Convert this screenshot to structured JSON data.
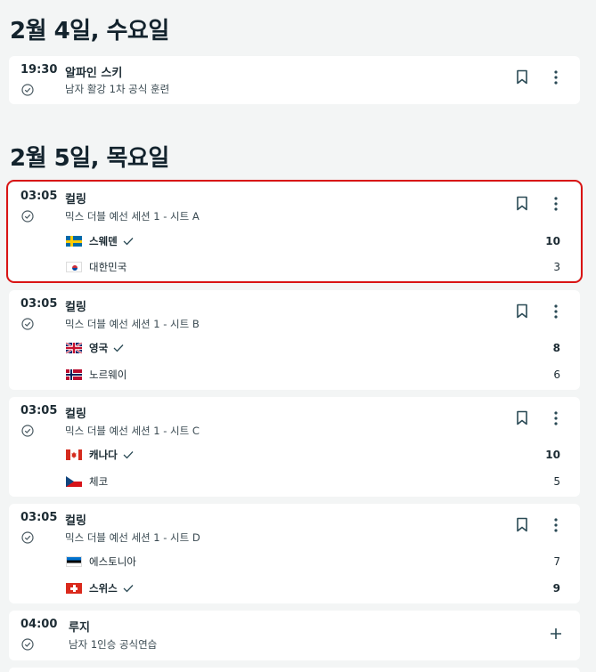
{
  "days": [
    {
      "title": "2월 4일, 수요일",
      "events": [
        {
          "time": "19:30",
          "sport": "알파인 스키",
          "event": "남자 활강 1차 공식 훈련"
        }
      ]
    },
    {
      "title": "2월 5일, 목요일",
      "events": [
        {
          "time": "03:05",
          "sport": "컬링",
          "event": "믹스 더블 예선 세션 1 - 시트 A",
          "teams": [
            {
              "name": "스웨덴",
              "score": "10",
              "winner": true,
              "flag": "sweden"
            },
            {
              "name": "대한민국",
              "score": "3",
              "winner": false,
              "flag": "korea"
            }
          ]
        },
        {
          "time": "03:05",
          "sport": "컬링",
          "event": "믹스 더블 예선 세션 1 - 시트 B",
          "teams": [
            {
              "name": "영국",
              "score": "8",
              "winner": true,
              "flag": "uk"
            },
            {
              "name": "노르웨이",
              "score": "6",
              "winner": false,
              "flag": "norway"
            }
          ]
        },
        {
          "time": "03:05",
          "sport": "컬링",
          "event": "믹스 더블 예선 세션 1 - 시트 C",
          "teams": [
            {
              "name": "캐나다",
              "score": "10",
              "winner": true,
              "flag": "canada"
            },
            {
              "name": "체코",
              "score": "5",
              "winner": false,
              "flag": "czech"
            }
          ]
        },
        {
          "time": "03:05",
          "sport": "컬링",
          "event": "믹스 더블 예선 세션 1 - 시트 D",
          "teams": [
            {
              "name": "에스토니아",
              "score": "7",
              "winner": false,
              "flag": "estonia"
            },
            {
              "name": "스위스",
              "score": "9",
              "winner": true,
              "flag": "switzerland"
            }
          ]
        },
        {
          "time": "04:00",
          "sport": "루지",
          "event": "남자 1인승 공식연습"
        }
      ]
    }
  ],
  "icons": {
    "check": "check-circle-icon",
    "bookmark": "bookmark-icon",
    "more": "more-vertical-icon",
    "add": "plus-icon"
  },
  "colors": {
    "highlight": "#d91414",
    "icon": "#2a4a55",
    "background": "#f3f5f5"
  }
}
